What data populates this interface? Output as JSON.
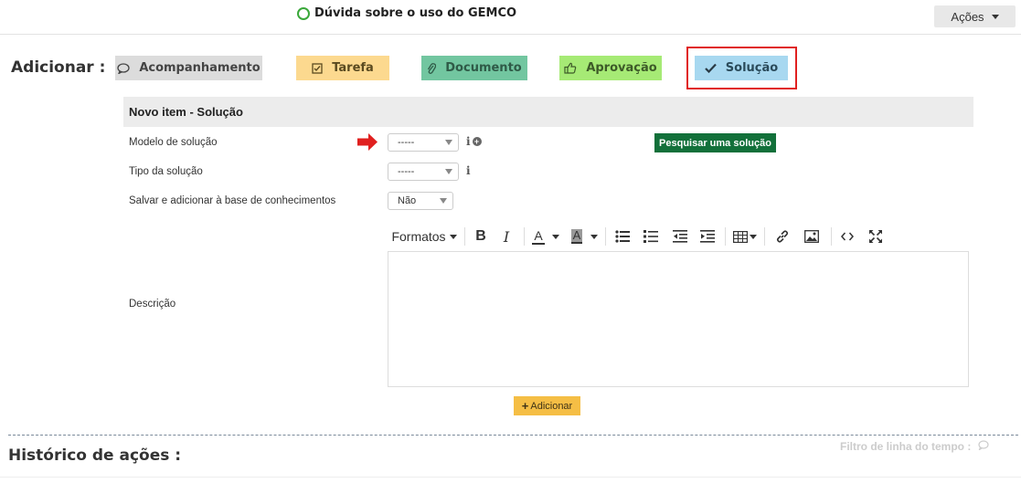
{
  "header": {
    "ticket_title": "Dúvida sobre o uso do GEMCO",
    "actions_label": "Ações"
  },
  "add_bar": {
    "label": "Adicionar :",
    "buttons": [
      {
        "label": "Acompanhamento",
        "icon": "comment-icon",
        "color": "#dcdcdc"
      },
      {
        "label": "Tarefa",
        "icon": "checkbox-icon",
        "color": "#fcd98f"
      },
      {
        "label": "Documento",
        "icon": "paperclip-icon",
        "color": "#72c6a0"
      },
      {
        "label": "Aprovação",
        "icon": "thumbs-up-icon",
        "color": "#a6ea75"
      },
      {
        "label": "Solução",
        "icon": "checkmark-icon",
        "color": "#a8d8f0",
        "highlighted": true
      }
    ]
  },
  "form": {
    "title": "Novo item - Solução",
    "fields": {
      "modelo": {
        "label": "Modelo de solução",
        "value": "-----"
      },
      "tipo": {
        "label": "Tipo da solução",
        "value": "-----"
      },
      "salvar": {
        "label": "Salvar e adicionar à base de conhecimentos",
        "value": "Não"
      },
      "descricao": {
        "label": "Descrição"
      }
    },
    "search_button": "Pesquisar uma solução",
    "submit_button": "Adicionar"
  },
  "editor_toolbar": {
    "formats_label": "Formatos",
    "bold": "B",
    "italic": "I",
    "text_color": "A",
    "bg_color": "A"
  },
  "history": {
    "title": "Histórico de ações :",
    "filter_label": "Filtro de linha do tempo :"
  },
  "colors": {
    "highlight_border": "#e0201f",
    "arrow": "#e0201f",
    "search_button": "#12703a",
    "submit_button": "#f5be45"
  }
}
